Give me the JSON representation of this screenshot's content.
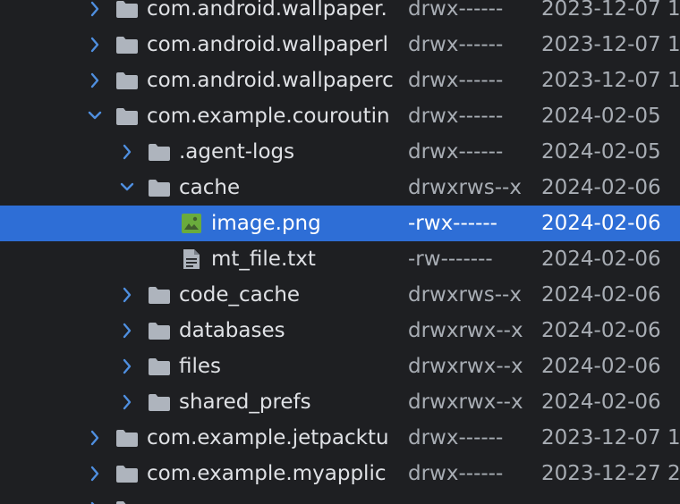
{
  "colors": {
    "background": "#1e1f22",
    "selection": "#2e6ed6",
    "chevron": "#4f8fe0",
    "folder": "#aeb4bd",
    "image_icon": "#6aab3c",
    "text": "#dfe1e5",
    "secondary_text": "#a8adb4"
  },
  "rows": [
    {
      "name": "com.android.wallpaper.",
      "perm": "drwx------",
      "date": "2023-12-07 1",
      "type": "folder",
      "expanded": false,
      "level": 0
    },
    {
      "name": "com.android.wallpaperl",
      "perm": "drwx------",
      "date": "2023-12-07 1",
      "type": "folder",
      "expanded": false,
      "level": 0
    },
    {
      "name": "com.android.wallpaperc",
      "perm": "drwx------",
      "date": "2023-12-07 1",
      "type": "folder",
      "expanded": false,
      "level": 0
    },
    {
      "name": "com.example.couroutin",
      "perm": "drwx------",
      "date": "2024-02-05",
      "type": "folder",
      "expanded": true,
      "level": 0
    },
    {
      "name": ".agent-logs",
      "perm": "drwx------",
      "date": "2024-02-05",
      "type": "folder",
      "expanded": false,
      "level": 1
    },
    {
      "name": "cache",
      "perm": "drwxrws--x",
      "date": "2024-02-06",
      "type": "folder",
      "expanded": true,
      "level": 1
    },
    {
      "name": "image.png",
      "perm": "-rwx------",
      "date": "2024-02-06",
      "type": "image",
      "level": 2,
      "selected": true
    },
    {
      "name": "mt_file.txt",
      "perm": "-rw-------",
      "date": "2024-02-06",
      "type": "text",
      "level": 2
    },
    {
      "name": "code_cache",
      "perm": "drwxrws--x",
      "date": "2024-02-06",
      "type": "folder",
      "expanded": false,
      "level": 1
    },
    {
      "name": "databases",
      "perm": "drwxrwx--x",
      "date": "2024-02-06",
      "type": "folder",
      "expanded": false,
      "level": 1
    },
    {
      "name": "files",
      "perm": "drwxrwx--x",
      "date": "2024-02-06",
      "type": "folder",
      "expanded": false,
      "level": 1
    },
    {
      "name": "shared_prefs",
      "perm": "drwxrwx--x",
      "date": "2024-02-06",
      "type": "folder",
      "expanded": false,
      "level": 1
    },
    {
      "name": "com.example.jetpacktu",
      "perm": "drwx------",
      "date": "2023-12-07 1",
      "type": "folder",
      "expanded": false,
      "level": 0
    },
    {
      "name": "com.example.myapplic",
      "perm": "drwx------",
      "date": "2023-12-27 2",
      "type": "folder",
      "expanded": false,
      "level": 0
    },
    {
      "name": "",
      "perm": "",
      "date": "",
      "type": "folder",
      "expanded": false,
      "level": 0
    }
  ]
}
